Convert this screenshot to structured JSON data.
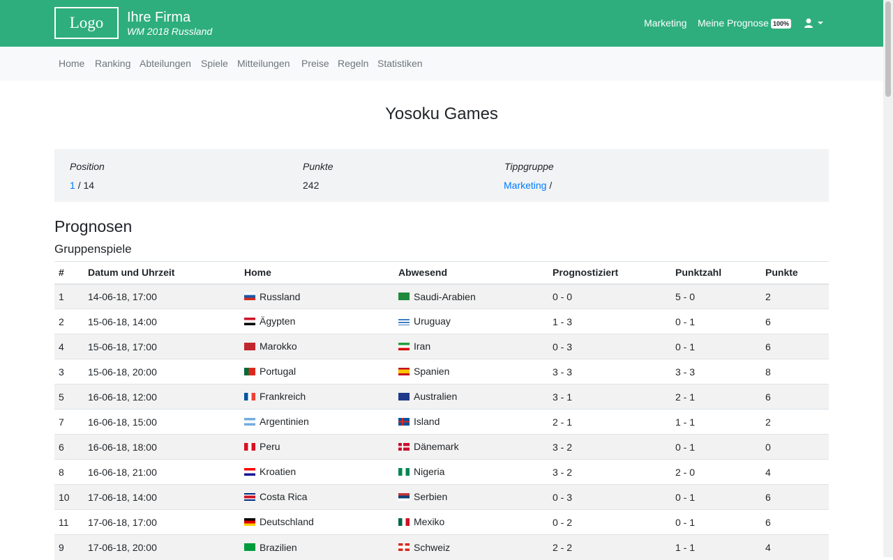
{
  "header": {
    "logo_text": "Logo",
    "company_name": "Ihre Firma",
    "tournament": "WM 2018 Russland",
    "nav_marketing": "Marketing",
    "nav_prognose": "Meine Prognose",
    "prognose_badge": "100%",
    "user_icon": "user-icon"
  },
  "subnav": {
    "items": [
      "Home",
      "Ranking",
      "Abteilungen",
      "Spiele",
      "Mitteilungen",
      "Preise",
      "Regeln",
      "Statistiken"
    ]
  },
  "page": {
    "title": "Yosoku Games"
  },
  "info": {
    "position_label": "Position",
    "position_value": "1",
    "position_total": "/ 14",
    "punkte_label": "Punkte",
    "punkte_value": "242",
    "tippgruppe_label": "Tippgruppe",
    "tippgruppe_value": "Marketing",
    "tippgruppe_suffix": "/"
  },
  "section": {
    "title": "Prognosen",
    "subtitle": "Gruppenspiele"
  },
  "table": {
    "headers": [
      "#",
      "Datum und Uhrzeit",
      "Home",
      "Abwesend",
      "Prognostiziert",
      "Punktzahl",
      "Punkte"
    ],
    "rows": [
      {
        "id": "1",
        "date": "14-06-18, 17:00",
        "home": "Russland",
        "away": "Saudi-Arabien",
        "prognose": "0 - 0",
        "score": "5 - 0",
        "points": "2"
      },
      {
        "id": "2",
        "date": "15-06-18, 14:00",
        "home": "Ägypten",
        "away": "Uruguay",
        "prognose": "1 - 3",
        "score": "0 - 1",
        "points": "6"
      },
      {
        "id": "4",
        "date": "15-06-18, 17:00",
        "home": "Marokko",
        "away": "Iran",
        "prognose": "0 - 3",
        "score": "0 - 1",
        "points": "6"
      },
      {
        "id": "3",
        "date": "15-06-18, 20:00",
        "home": "Portugal",
        "away": "Spanien",
        "prognose": "3 - 3",
        "score": "3 - 3",
        "points": "8"
      },
      {
        "id": "5",
        "date": "16-06-18, 12:00",
        "home": "Frankreich",
        "away": "Australien",
        "prognose": "3 - 1",
        "score": "2 - 1",
        "points": "6"
      },
      {
        "id": "7",
        "date": "16-06-18, 15:00",
        "home": "Argentinien",
        "away": "Island",
        "prognose": "2 - 1",
        "score": "1 - 1",
        "points": "2"
      },
      {
        "id": "6",
        "date": "16-06-18, 18:00",
        "home": "Peru",
        "away": "Dänemark",
        "prognose": "3 - 2",
        "score": "0 - 1",
        "points": "0"
      },
      {
        "id": "8",
        "date": "16-06-18, 21:00",
        "home": "Kroatien",
        "away": "Nigeria",
        "prognose": "3 - 2",
        "score": "2 - 0",
        "points": "4"
      },
      {
        "id": "10",
        "date": "17-06-18, 14:00",
        "home": "Costa Rica",
        "away": "Serbien",
        "prognose": "0 - 3",
        "score": "0 - 1",
        "points": "6"
      },
      {
        "id": "11",
        "date": "17-06-18, 17:00",
        "home": "Deutschland",
        "away": "Mexiko",
        "prognose": "0 - 2",
        "score": "0 - 1",
        "points": "6"
      },
      {
        "id": "9",
        "date": "17-06-18, 20:00",
        "home": "Brazilien",
        "away": "Schweiz",
        "prognose": "2 - 2",
        "score": "1 - 1",
        "points": "4"
      }
    ]
  },
  "colors": {
    "header_bg": "#2eae7d",
    "subnav_bg": "#f8f9fa",
    "link": "#007bff",
    "panel_bg": "#f2f3f5",
    "row_stripe": "#f2f2f2"
  }
}
